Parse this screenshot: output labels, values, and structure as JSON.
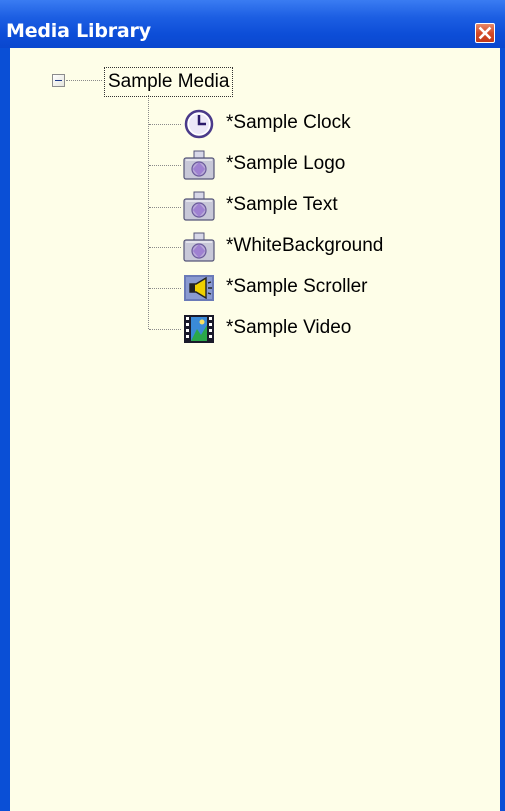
{
  "panel": {
    "title": "Media Library",
    "close_icon": "close-x-icon",
    "colors": {
      "titlebar": "#0a4fd6",
      "content_bg": "#fefee8",
      "close_button": "#d44a28"
    }
  },
  "tree": {
    "root": {
      "label": "Sample Media",
      "expanded": true,
      "expander_icon": "collapse-minus-icon"
    },
    "items": [
      {
        "label": "*Sample Clock",
        "icon": "clock-icon"
      },
      {
        "label": "*Sample Logo",
        "icon": "camera-image-icon"
      },
      {
        "label": "*Sample Text",
        "icon": "camera-image-icon"
      },
      {
        "label": "*WhiteBackground",
        "icon": "camera-image-icon"
      },
      {
        "label": "*Sample Scroller",
        "icon": "megaphone-scroller-icon"
      },
      {
        "label": "*Sample Video",
        "icon": "film-video-icon"
      }
    ]
  }
}
